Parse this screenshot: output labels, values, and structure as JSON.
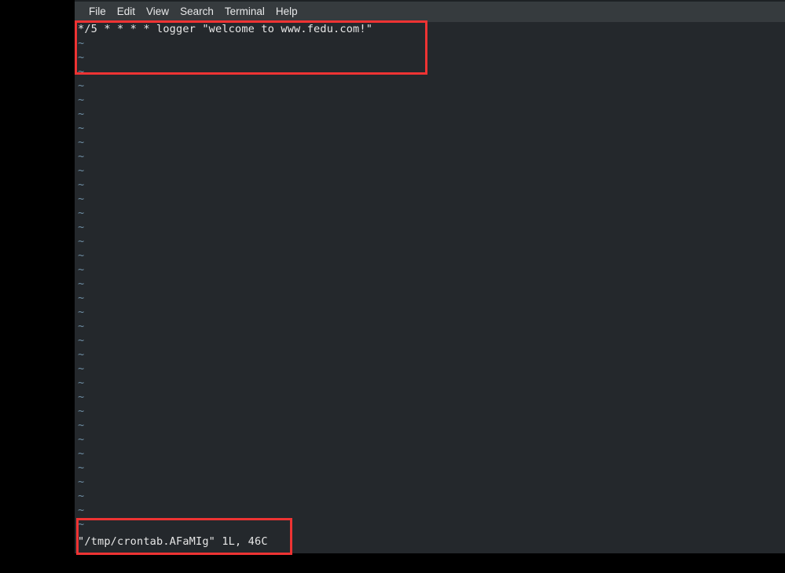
{
  "window": {
    "background_color": "#24282c",
    "desktop_color": "#000000"
  },
  "menu_bar": {
    "background_color": "#363b3e",
    "items": [
      {
        "label": "File",
        "name": "menu-file"
      },
      {
        "label": "Edit",
        "name": "menu-edit"
      },
      {
        "label": "View",
        "name": "menu-view"
      },
      {
        "label": "Search",
        "name": "menu-search"
      },
      {
        "label": "Terminal",
        "name": "menu-terminal"
      },
      {
        "label": "Help",
        "name": "menu-help"
      }
    ]
  },
  "editor": {
    "first_line": "*/5 * * * * logger \"welcome to www.fedu.com!\"",
    "empty_line_marker": "~",
    "empty_line_count": 35,
    "text_color": "#e6e6e6",
    "tilde_color": "#6f8fa6"
  },
  "status_line": {
    "text": "\"/tmp/crontab.AFaMIg\" 1L, 46C",
    "file_path": "/tmp/crontab.AFaMIg",
    "lines": "1L",
    "chars": "46C"
  },
  "annotations": {
    "accent_color": "#ee3333",
    "boxes": [
      {
        "name": "annotation-box-command",
        "target": "crontab entry line"
      },
      {
        "name": "annotation-box-status",
        "target": "vim status line"
      }
    ]
  }
}
